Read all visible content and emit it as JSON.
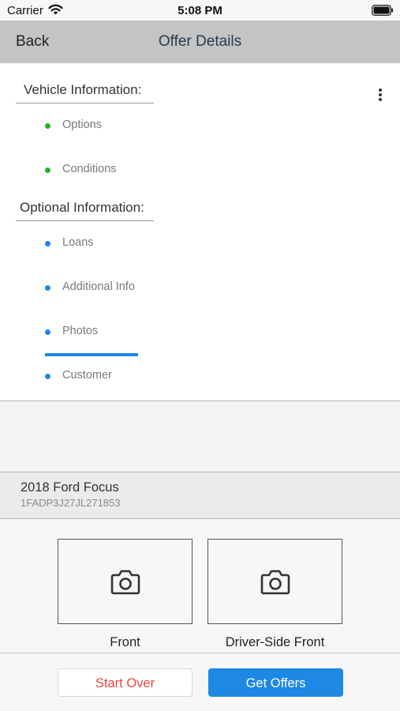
{
  "status_bar": {
    "carrier": "Carrier",
    "time": "5:08 PM"
  },
  "nav": {
    "back_label": "Back",
    "title": "Offer Details"
  },
  "sections": {
    "vehicle_info": {
      "header": "Vehicle Information:",
      "items": [
        {
          "label": "Options"
        },
        {
          "label": "Conditions"
        }
      ]
    },
    "optional_info": {
      "header": "Optional Information:",
      "items": [
        {
          "label": "Loans"
        },
        {
          "label": "Additional Info"
        },
        {
          "label": "Photos"
        },
        {
          "label": "Customer"
        }
      ]
    },
    "active_item": "Photos"
  },
  "vehicle": {
    "name": "2018 Ford Focus",
    "vin": "1FADP3J27JL271853"
  },
  "photos": [
    {
      "label": "Front",
      "icon": "camera-icon"
    },
    {
      "label": "Driver-Side Front",
      "icon": "camera-icon"
    }
  ],
  "actions": {
    "start_over": "Start Over",
    "get_offers": "Get Offers"
  },
  "colors": {
    "nav_bg": "#c4c4c4",
    "accent_blue": "#1e88e5",
    "vehicle_dot": "#22b322",
    "start_over_text": "#e84545"
  }
}
